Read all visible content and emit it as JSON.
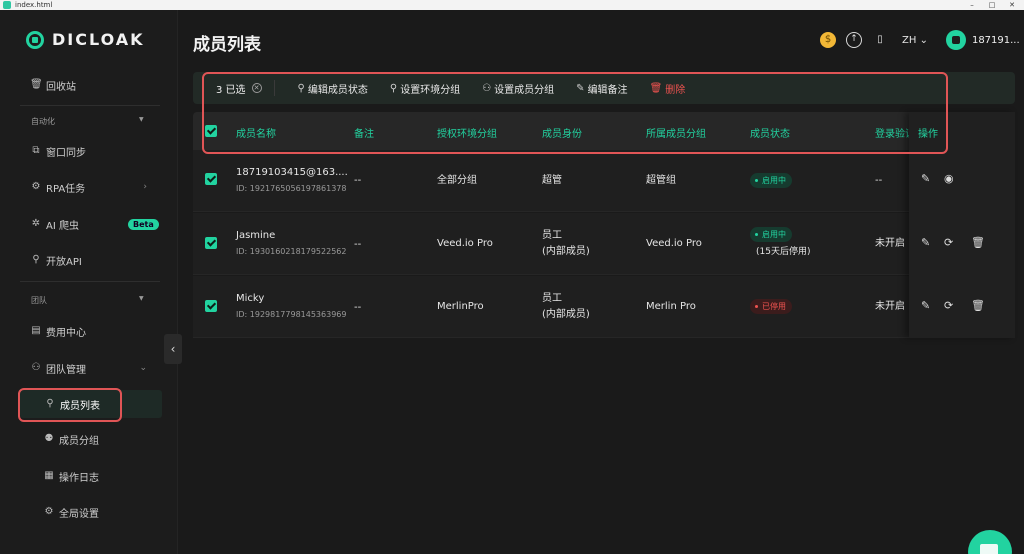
{
  "window": {
    "title": "index.html",
    "controls": [
      "–",
      "□",
      "✕"
    ]
  },
  "sidebar": {
    "logo": "DICLOAK",
    "items": {
      "recycle": "回收站",
      "section_automation": "自动化",
      "window_sync": "窗口同步",
      "rpa": "RPA任务",
      "ai_crawler": "AI 爬虫",
      "beta": "Beta",
      "open_api": "开放API",
      "section_team": "团队",
      "billing": "费用中心",
      "team_manage": "团队管理",
      "member_list": "成员列表",
      "member_group": "成员分组",
      "op_log": "操作日志",
      "global_settings": "全局设置"
    },
    "collapse_glyph": "‹"
  },
  "header": {
    "title": "成员列表",
    "lang": "ZH",
    "username": "187191..."
  },
  "toolbar": {
    "selected": "3 已选",
    "edit_status": "编辑成员状态",
    "set_env_group": "设置环境分组",
    "set_member_group": "设置成员分组",
    "edit_note": "编辑备注",
    "delete": "删除"
  },
  "table": {
    "columns": [
      "成员名称",
      "备注",
      "授权环境分组",
      "成员身份",
      "所属成员分组",
      "成员状态",
      "登录验证",
      "操作"
    ],
    "rows": [
      {
        "name": "18719103415@163....",
        "id": "ID: 1921765056197861378",
        "note": "--",
        "env_group": "全部分组",
        "role1": "超管",
        "role2": "",
        "member_group": "超管组",
        "status": "启用中",
        "status_extra": "",
        "login_verify": "--"
      },
      {
        "name": "Jasmine",
        "id": "ID: 1930160218179522562",
        "note": "--",
        "env_group": "Veed.io Pro",
        "role1": "员工",
        "role2": "(内部成员)",
        "member_group": "Veed.io Pro",
        "status": "启用中",
        "status_extra": "(15天后停用)",
        "login_verify": "未开启"
      },
      {
        "name": "Micky",
        "id": "ID: 1929817798145363969",
        "note": "--",
        "env_group": "MerlinPro",
        "role1": "员工",
        "role2": "(内部成员)",
        "member_group": "Merlin Pro",
        "status": "已停用",
        "status_extra": "",
        "login_verify": "未开启"
      }
    ]
  },
  "colors": {
    "accent": "#22d3a0",
    "danger": "#ef5350",
    "highlight_box": "#e05556",
    "background": "#1a1a1a"
  },
  "icons": [
    "recycle-bin-icon",
    "window-sync-icon",
    "rpa-icon",
    "ai-crawler-icon",
    "api-icon",
    "billing-icon",
    "team-icon",
    "member-icon",
    "group-icon",
    "log-icon",
    "settings-icon",
    "coin-icon",
    "upload-icon",
    "book-icon",
    "chevron-down-icon",
    "edit-icon",
    "user-circle-icon",
    "switch-icon",
    "delete-icon"
  ]
}
